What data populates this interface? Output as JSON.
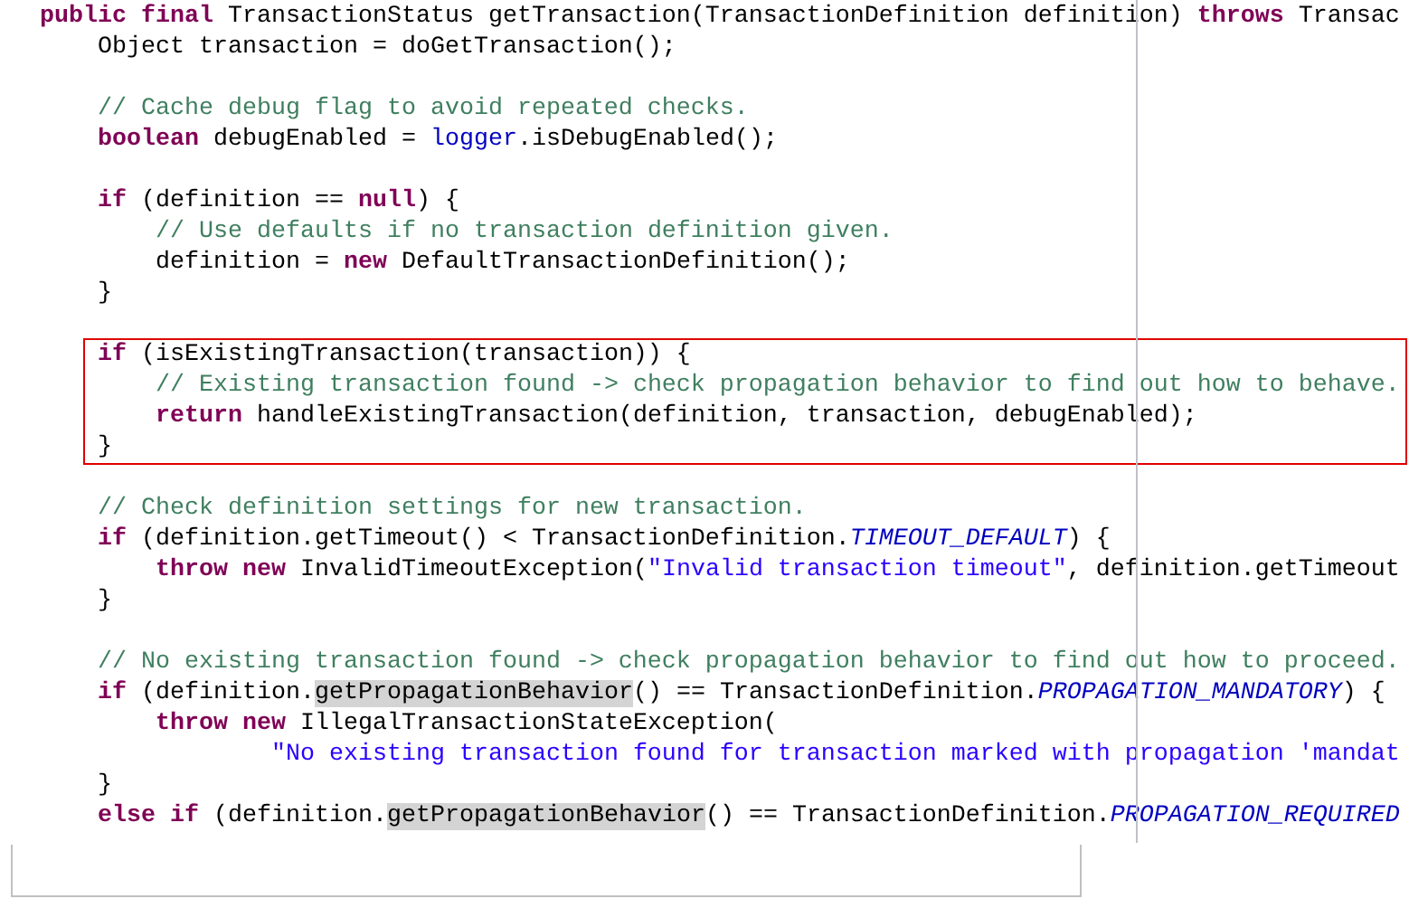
{
  "editor": {
    "sections": [
      {
        "framed": false,
        "lines": [
          {
            "kind": "code",
            "tokens": [
              {
                "kind": "keyword",
                "text": "public final"
              },
              {
                "kind": "plain",
                "text": " TransactionStatus getTransaction(TransactionDefinition definition) "
              },
              {
                "kind": "keyword",
                "text": "throws"
              },
              {
                "kind": "plain",
                "text": " Transac"
              }
            ]
          },
          {
            "kind": "code",
            "tokens": [
              {
                "kind": "plain",
                "text": "    Object transaction = doGetTransaction();"
              }
            ]
          },
          {
            "kind": "blank"
          },
          {
            "kind": "code",
            "tokens": [
              {
                "kind": "comment",
                "text": "    // Cache debug flag to avoid repeated checks."
              }
            ]
          },
          {
            "kind": "code",
            "tokens": [
              {
                "kind": "keyword",
                "text": "    boolean"
              },
              {
                "kind": "plain",
                "text": " debugEnabled = "
              },
              {
                "kind": "field",
                "text": "logger"
              },
              {
                "kind": "plain",
                "text": ".isDebugEnabled();"
              }
            ]
          },
          {
            "kind": "blank"
          },
          {
            "kind": "code",
            "tokens": [
              {
                "kind": "keyword",
                "text": "    if"
              },
              {
                "kind": "plain",
                "text": " (definition == "
              },
              {
                "kind": "keyword",
                "text": "null"
              },
              {
                "kind": "plain",
                "text": ") {"
              }
            ]
          },
          {
            "kind": "code",
            "tokens": [
              {
                "kind": "comment",
                "text": "        // Use defaults if no transaction definition given."
              }
            ]
          },
          {
            "kind": "code",
            "tokens": [
              {
                "kind": "plain",
                "text": "        definition = "
              },
              {
                "kind": "keyword",
                "text": "new"
              },
              {
                "kind": "plain",
                "text": " DefaultTransactionDefinition();"
              }
            ]
          },
          {
            "kind": "code",
            "tokens": [
              {
                "kind": "plain",
                "text": "    }"
              }
            ]
          },
          {
            "kind": "blank"
          }
        ]
      },
      {
        "framed": true,
        "lines": [
          {
            "kind": "code",
            "tokens": [
              {
                "kind": "keyword",
                "text": "    if"
              },
              {
                "kind": "plain",
                "text": " (isExistingTransaction(transaction)) {"
              }
            ]
          },
          {
            "kind": "code",
            "tokens": [
              {
                "kind": "comment",
                "text": "        // Existing transaction found -> check propagation behavior to find out how to behave."
              }
            ]
          },
          {
            "kind": "code",
            "tokens": [
              {
                "kind": "keyword",
                "text": "        return"
              },
              {
                "kind": "plain",
                "text": " handleExistingTransaction(definition, transaction, debugEnabled);"
              }
            ]
          },
          {
            "kind": "code",
            "tokens": [
              {
                "kind": "plain",
                "text": "    }"
              }
            ]
          }
        ]
      },
      {
        "framed": false,
        "lines": [
          {
            "kind": "blank"
          },
          {
            "kind": "code",
            "tokens": [
              {
                "kind": "comment",
                "text": "    // Check definition settings for new transaction."
              }
            ]
          },
          {
            "kind": "code",
            "tokens": [
              {
                "kind": "keyword",
                "text": "    if"
              },
              {
                "kind": "plain",
                "text": " (definition.getTimeout() < TransactionDefinition."
              },
              {
                "kind": "constant",
                "text": "TIMEOUT_DEFAULT"
              },
              {
                "kind": "plain",
                "text": ") {"
              }
            ]
          },
          {
            "kind": "code",
            "tokens": [
              {
                "kind": "keyword",
                "text": "        throw new"
              },
              {
                "kind": "plain",
                "text": " InvalidTimeoutException("
              },
              {
                "kind": "string",
                "text": "\"Invalid transaction timeout\""
              },
              {
                "kind": "plain",
                "text": ", definition.getTimeout"
              }
            ]
          },
          {
            "kind": "code",
            "tokens": [
              {
                "kind": "plain",
                "text": "    }"
              }
            ]
          },
          {
            "kind": "blank"
          },
          {
            "kind": "code",
            "tokens": [
              {
                "kind": "comment",
                "text": "    // No existing transaction found -> check propagation behavior to find out how to proceed."
              }
            ]
          },
          {
            "kind": "code",
            "tokens": [
              {
                "kind": "keyword",
                "text": "    if"
              },
              {
                "kind": "plain",
                "text": " (definition."
              },
              {
                "kind": "occurrence",
                "text": "getPropagationBehavior"
              },
              {
                "kind": "plain",
                "text": "() == TransactionDefinition."
              },
              {
                "kind": "constant",
                "text": "PROPAGATION_MANDATORY"
              },
              {
                "kind": "plain",
                "text": ") {"
              }
            ]
          },
          {
            "kind": "code",
            "tokens": [
              {
                "kind": "keyword",
                "text": "        throw new"
              },
              {
                "kind": "plain",
                "text": " IllegalTransactionStateException("
              }
            ]
          },
          {
            "kind": "code",
            "tokens": [
              {
                "kind": "string",
                "text": "                \"No existing transaction found for transaction marked with propagation 'mandat"
              }
            ]
          },
          {
            "kind": "code",
            "tokens": [
              {
                "kind": "plain",
                "text": "    }"
              }
            ]
          },
          {
            "kind": "code",
            "tokens": [
              {
                "kind": "keyword",
                "text": "    else if"
              },
              {
                "kind": "plain",
                "text": " (definition."
              },
              {
                "kind": "occurrence",
                "text": "getPropagationBehavior"
              },
              {
                "kind": "plain",
                "text": "() == TransactionDefinition."
              },
              {
                "kind": "constant",
                "text": "PROPAGATION_REQUIRED"
              }
            ]
          }
        ]
      }
    ]
  }
}
